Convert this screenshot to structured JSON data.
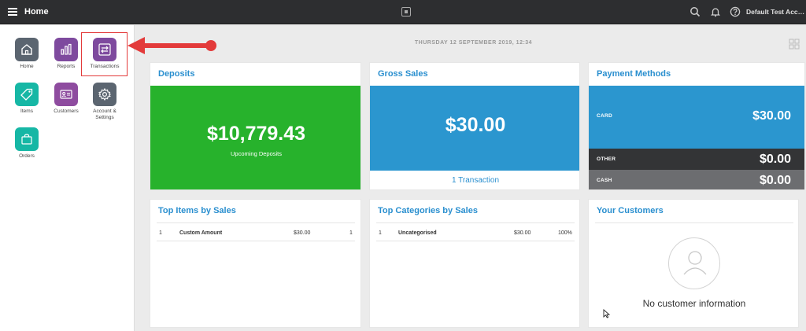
{
  "topbar": {
    "title": "Home",
    "account": "Default Test Account",
    "icons": [
      "menu-icon",
      "square-logo-icon",
      "search-icon",
      "bell-icon",
      "help-icon"
    ]
  },
  "sidebar": {
    "items": [
      {
        "label": "Home",
        "icon": "home-icon",
        "color": "#5b6570"
      },
      {
        "label": "Reports",
        "icon": "bar-chart-icon",
        "color": "#7e4a9e"
      },
      {
        "label": "Transactions",
        "icon": "transfer-icon",
        "color": "#7e4a9e"
      },
      {
        "label": "Items",
        "icon": "tag-icon",
        "color": "#16b7a5"
      },
      {
        "label": "Customers",
        "icon": "id-card-icon",
        "color": "#8e4c9f"
      },
      {
        "label": "Account & Settings",
        "icon": "gear-icon",
        "color": "#5b6570"
      },
      {
        "label": "Orders",
        "icon": "bag-icon",
        "color": "#16b7a5"
      }
    ]
  },
  "main": {
    "date": "THURSDAY 12 SEPTEMBER 2019, 12:34",
    "deposits": {
      "title": "Deposits",
      "amount": "$10,779.43",
      "sublabel": "Upcoming Deposits",
      "color": "#27b22c"
    },
    "gross_sales": {
      "title": "Gross Sales",
      "amount": "$30.00",
      "link": "1 Transaction",
      "color": "#2b96cf"
    },
    "payment_methods": {
      "title": "Payment Methods",
      "rows": [
        {
          "label": "CARD",
          "value": "$30.00",
          "color": "#2b96cf"
        },
        {
          "label": "OTHER",
          "value": "$0.00",
          "color": "#333436"
        },
        {
          "label": "CASH",
          "value": "$0.00",
          "color": "#6c6d70"
        }
      ]
    },
    "top_items": {
      "title": "Top Items by Sales",
      "rows": [
        {
          "rank": "1",
          "name": "Custom Amount",
          "amount": "$30.00",
          "qty": "1"
        }
      ]
    },
    "top_categories": {
      "title": "Top Categories by Sales",
      "rows": [
        {
          "rank": "1",
          "name": "Uncategorised",
          "amount": "$30.00",
          "pct": "100%"
        }
      ]
    },
    "your_customers": {
      "title": "Your Customers",
      "empty": "No customer information"
    }
  }
}
